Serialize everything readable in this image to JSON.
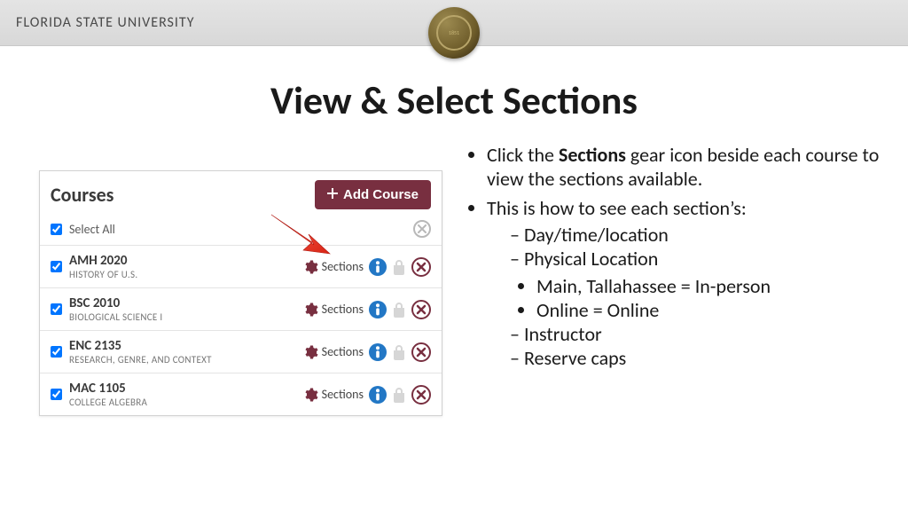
{
  "header": {
    "university": "FLORIDA STATE UNIVERSITY",
    "seal_year": "1851"
  },
  "page_title": "View & Select Sections",
  "panel": {
    "title": "Courses",
    "add_button": "Add Course",
    "select_all": "Select All",
    "sections_label": "Sections",
    "courses": [
      {
        "code": "AMH 2020",
        "desc": "HISTORY OF U.S."
      },
      {
        "code": "BSC 2010",
        "desc": "BIOLOGICAL SCIENCE I"
      },
      {
        "code": "ENC 2135",
        "desc": "RESEARCH, GENRE, AND CONTEXT"
      },
      {
        "code": "MAC 1105",
        "desc": "COLLEGE ALGEBRA"
      }
    ]
  },
  "instructions": {
    "bullet1_pre": "Click the ",
    "bullet1_bold": "Sections",
    "bullet1_post": " gear icon beside each course to view the sections available.",
    "bullet2": "This is how to see each section’s:",
    "sub": {
      "a": "Day/time/location",
      "b": "Physical Location",
      "b1": "Main, Tallahassee = In-person",
      "b2": "Online = Online",
      "c": "Instructor",
      "d": "Reserve caps"
    }
  },
  "colors": {
    "garnet": "#782f40",
    "info_blue": "#2277c5",
    "arrow_red": "#ff3b30"
  }
}
